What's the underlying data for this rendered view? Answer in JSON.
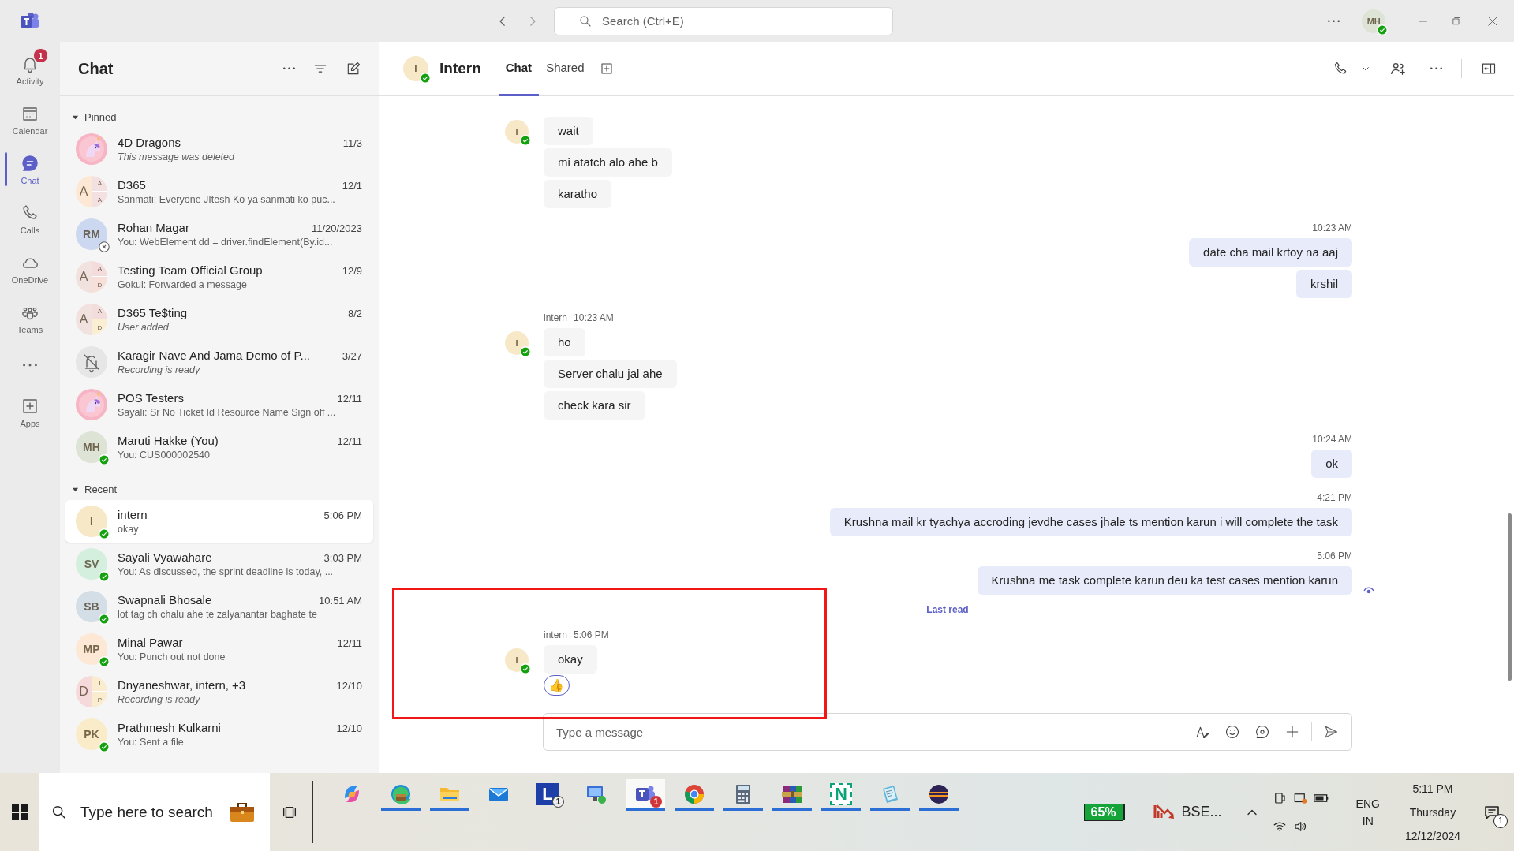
{
  "titlebar": {
    "search_placeholder": "Search (Ctrl+E)",
    "user": {
      "kind": "initials",
      "initials": "MH",
      "color": "#dde3d5",
      "available": true
    }
  },
  "rail": [
    {
      "kind": "bell",
      "label": "Activity",
      "badge": "1",
      "selected": false
    },
    {
      "kind": "calendar",
      "label": "Calendar",
      "selected": false
    },
    {
      "kind": "chat",
      "label": "Chat",
      "selected": true
    },
    {
      "kind": "phone",
      "label": "Calls",
      "selected": false
    },
    {
      "kind": "cloud",
      "label": "OneDrive",
      "selected": false
    },
    {
      "kind": "people",
      "label": "Teams",
      "selected": false
    },
    {
      "kind": "more",
      "selected": false
    },
    {
      "kind": "apps",
      "label": "Apps",
      "selected": false
    }
  ],
  "chat_list": {
    "title": "Chat",
    "sections": [
      {
        "label": "Pinned",
        "expanded": true,
        "items": [
          {
            "name": "4D Dragons",
            "time": "11/3",
            "preview": "This message was deleted",
            "italic": true,
            "selected": false
          },
          {
            "name": "D365",
            "time": "12/1",
            "preview": "Sanmati: Everyone JItesh Ko ya sanmati ko puc...",
            "italic": false,
            "selected": false,
            "avatar": {
              "kind": "group",
              "initials": "A",
              "color": "#fce8d4",
              "members": [
                {
                  "initials": "A",
                  "color": "#f3e0e0"
                },
                {
                  "initials": "A",
                  "color": "#f3e0e0"
                }
              ]
            }
          },
          {
            "name": "Rohan Magar",
            "time": "11/20/2023",
            "preview": "You: WebElement dd = driver.findElement(By.id...",
            "italic": false,
            "selected": false,
            "avatar": {
              "kind": "initials",
              "initials": "RM",
              "color": "#cbd8ef",
              "available": false
            }
          },
          {
            "name": "Testing Team Official Group",
            "time": "12/9",
            "preview": "Gokul: Forwarded a message",
            "italic": false,
            "selected": false,
            "avatar": {
              "kind": "group",
              "initials": "A",
              "color": "#f2e2df",
              "members": [
                {
                  "initials": "A",
                  "color": "#f5dcdc"
                },
                {
                  "initials": "D",
                  "color": "#f7e0da"
                }
              ]
            }
          },
          {
            "name": "D365 Te$ting",
            "time": "8/2",
            "preview": "User added",
            "italic": true,
            "selected": false,
            "avatar": {
              "kind": "group",
              "initials": "A",
              "color": "#f2e2df",
              "members": [
                {
                  "initials": "A",
                  "color": "#f3dcdc"
                },
                {
                  "initials": "D",
                  "color": "#faefd2"
                }
              ]
            }
          },
          {
            "name": "Karagir Nave And Jama Demo of P...",
            "time": "3/27",
            "preview": "Recording is ready",
            "italic": true,
            "selected": false,
            "avatar": {
              "kind": "muted"
            }
          },
          {
            "name": "POS Testers",
            "time": "12/11",
            "preview": "Sayali: Sr No Ticket Id Resource Name Sign off ...",
            "italic": false,
            "selected": false
          },
          {
            "name": "Maruti Hakke (You)",
            "time": "12/11",
            "preview": "You: CUS000002540",
            "italic": false,
            "selected": false,
            "avatar": {
              "kind": "initials",
              "initials": "MH",
              "color": "#dde3d5",
              "available": true
            }
          }
        ]
      },
      {
        "label": "Recent",
        "expanded": true,
        "items": [
          {
            "name": "intern",
            "time": "5:06 PM",
            "preview": "okay",
            "italic": false,
            "selected": true,
            "avatar": {
              "kind": "initials",
              "initials": "I",
              "color": "#f7e8c8",
              "available": true
            }
          },
          {
            "name": "Sayali Vyawahare",
            "time": "3:03 PM",
            "preview": "You: As discussed, the sprint deadline is today, ...",
            "italic": false,
            "selected": false,
            "avatar": {
              "kind": "initials",
              "initials": "SV",
              "color": "#d5efdf",
              "available": true
            }
          },
          {
            "name": "Swapnali Bhosale",
            "time": "10:51 AM",
            "preview": "lot tag ch chalu ahe te zalyanantar baghate te",
            "italic": false,
            "selected": false,
            "avatar": {
              "kind": "initials",
              "initials": "SB",
              "color": "#d3dee6",
              "available": true
            }
          },
          {
            "name": "Minal Pawar",
            "time": "12/11",
            "preview": "You: Punch out not done",
            "italic": false,
            "selected": false,
            "avatar": {
              "kind": "initials",
              "initials": "MP",
              "color": "#fde8d5",
              "available": true
            }
          },
          {
            "name": "Dnyaneshwar, intern, +3",
            "time": "12/10",
            "preview": "Recording is ready",
            "italic": true,
            "selected": false,
            "avatar": {
              "kind": "group",
              "initials": "D",
              "color": "#f6dadb",
              "members": [
                {
                  "initials": "I",
                  "color": "#faeccf"
                },
                {
                  "initials": "P",
                  "color": "#faeccf"
                }
              ]
            }
          },
          {
            "name": "Prathmesh Kulkarni",
            "time": "12/10",
            "preview": "You: Sent a file",
            "italic": false,
            "selected": false,
            "avatar": {
              "kind": "initials",
              "initials": "PK",
              "color": "#fbecc9",
              "available": true
            }
          }
        ]
      }
    ]
  },
  "conversation": {
    "title": "intern",
    "avatar": {
      "kind": "initials",
      "initials": "I",
      "color": "#f7e8c8",
      "available": true
    },
    "tabs": [
      {
        "label": "Chat",
        "selected": true
      },
      {
        "label": "Shared",
        "selected": false
      }
    ]
  },
  "messages": [
    {
      "kind": "incoming",
      "avatar": {
        "kind": "initials",
        "initials": "I",
        "color": "#f7e8c8",
        "available": true
      },
      "bubbles": [
        {
          "text": "wait"
        },
        {
          "text": "mi atatch alo ahe b"
        },
        {
          "text": "karatho"
        }
      ]
    },
    {
      "kind": "outgoing",
      "time": "10:23 AM",
      "seen": false,
      "bubbles": [
        {
          "text": "date cha mail krtoy na aaj"
        },
        {
          "text": "krshil"
        }
      ]
    },
    {
      "kind": "incoming",
      "sender": "intern",
      "time": "10:23 AM",
      "avatar": {
        "kind": "initials",
        "initials": "I",
        "color": "#f7e8c8",
        "available": true
      },
      "bubbles": [
        {
          "text": "ho"
        },
        {
          "text": "Server chalu jal ahe"
        },
        {
          "text": "check kara sir"
        }
      ]
    },
    {
      "kind": "outgoing",
      "time": "10:24 AM",
      "seen": false,
      "bubbles": [
        {
          "text": "ok"
        }
      ]
    },
    {
      "kind": "outgoing",
      "time": "4:21 PM",
      "seen": false,
      "bubbles": [
        {
          "text": "Krushna mail kr tyachya accroding jevdhe cases jhale ts mention karun i will complete the task"
        }
      ]
    },
    {
      "kind": "outgoing",
      "time": "5:06 PM",
      "seen": true,
      "bubbles": [
        {
          "text": "Krushna me task complete karun deu ka test cases mention karun"
        }
      ]
    },
    {
      "kind": "divider",
      "label": "Last read"
    },
    {
      "kind": "incoming",
      "sender": "intern",
      "time": "5:06 PM",
      "avatar": {
        "kind": "initials",
        "initials": "I",
        "color": "#f7e8c8",
        "available": true
      },
      "bubbles": [
        {
          "text": "okay",
          "reactions": [
            "👍"
          ]
        }
      ]
    }
  ],
  "composer": {
    "placeholder": "Type a message"
  },
  "taskbar": {
    "search_placeholder": "Type here to search",
    "apps": [
      {
        "kind": "copilot",
        "running": false,
        "focused": false
      },
      {
        "kind": "edge",
        "running": true,
        "focused": false
      },
      {
        "kind": "files",
        "running": true,
        "focused": false
      },
      {
        "kind": "mail",
        "running": false,
        "focused": false
      },
      {
        "kind": "launcher",
        "glyph": "L",
        "badge": "1",
        "running": false,
        "focused": false
      },
      {
        "kind": "remote",
        "running": false,
        "focused": false
      },
      {
        "kind": "teams",
        "badge": "1",
        "running": true,
        "focused": true
      },
      {
        "kind": "chrome",
        "running": true,
        "focused": false
      },
      {
        "kind": "calculator",
        "running": true,
        "focused": false
      },
      {
        "kind": "archive",
        "running": true,
        "focused": false
      },
      {
        "kind": "notes",
        "glyph": "N",
        "running": true,
        "focused": false
      },
      {
        "kind": "notepad",
        "running": true,
        "focused": false
      },
      {
        "kind": "eclipse",
        "running": true,
        "focused": false
      }
    ],
    "battery": "65%",
    "ticker": "BSE...",
    "language": "ENG",
    "region": "IN",
    "time": "5:11 PM",
    "day": "Thursday",
    "date": "12/12/2024",
    "notifications": "1"
  }
}
